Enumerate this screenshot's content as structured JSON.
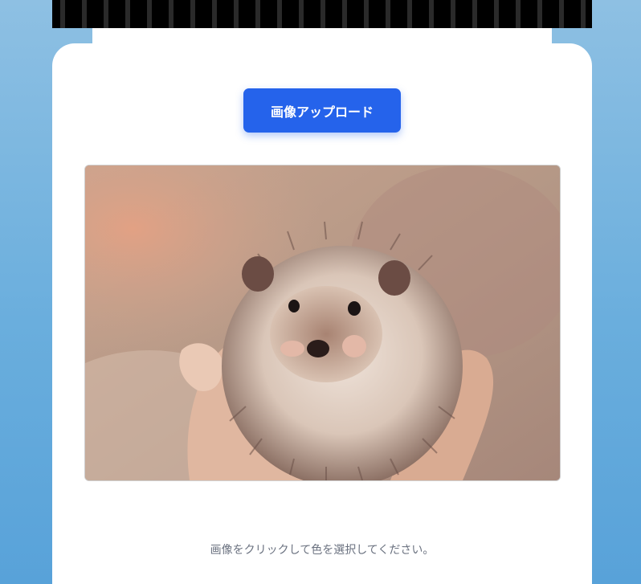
{
  "upload": {
    "button_label": "画像アップロード"
  },
  "image": {
    "alt": "hedgehog-photo"
  },
  "instructions": {
    "text": "画像をクリックして色を選択してください。"
  },
  "colors": {
    "accent": "#2563eb",
    "film_strip": "#000000",
    "background_top": "#8ec0e3",
    "background_bottom": "#58a2d9",
    "card": "#ffffff",
    "instruction_text": "#6b7280"
  },
  "icons": {
    "film_strip": "film-strip-icon"
  }
}
